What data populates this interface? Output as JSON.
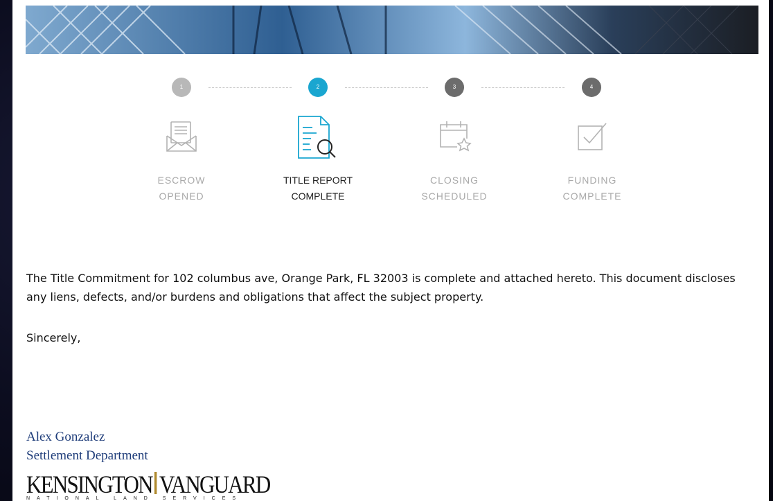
{
  "steps": [
    {
      "number": "1",
      "label": "ESCROW\nOPENED",
      "icon": "envelope-letter-icon",
      "state": "done"
    },
    {
      "number": "2",
      "label": "TITLE REPORT\nCOMPLETE",
      "icon": "document-search-icon",
      "state": "active"
    },
    {
      "number": "3",
      "label": "CLOSING\nSCHEDULED",
      "icon": "calendar-star-icon",
      "state": "pending"
    },
    {
      "number": "4",
      "label": "FUNDING\nCOMPLETE",
      "icon": "checkbox-icon",
      "state": "pending"
    }
  ],
  "message": {
    "body": "The Title Commitment for 102 columbus ave, Orange Park, FL 32003 is complete and attached hereto. This document discloses any liens, defects, and/or burdens and obligations that affect the subject property.",
    "closing": "Sincerely,"
  },
  "signature": {
    "name": "Alex Gonzalez",
    "department": "Settlement Department"
  },
  "logo": {
    "left": "KENSINGTON",
    "right": "VANGUARD",
    "tagline": "NATIONAL LAND SERVICES"
  },
  "colors": {
    "active": "#1aa6d0",
    "done": "#b8b8b8",
    "pending": "#6c6c6c",
    "signature": "#1f3d7a"
  }
}
